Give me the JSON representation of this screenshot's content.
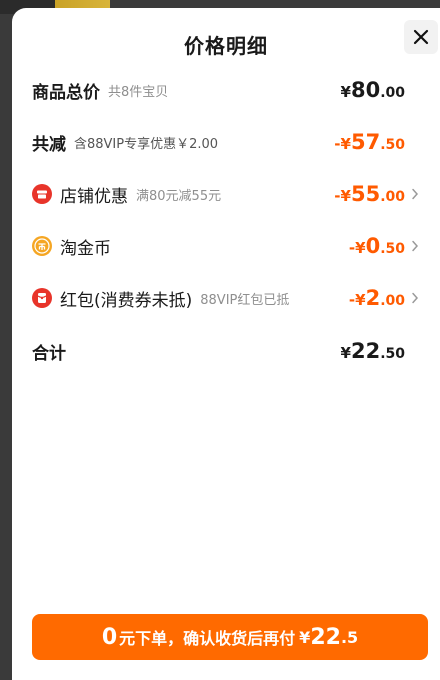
{
  "header": {
    "title": "价格明细"
  },
  "rows": {
    "total": {
      "label": "商品总价",
      "note": "共8件宝贝",
      "sign": "¥",
      "int": "80",
      "dec": ".00"
    },
    "reduce": {
      "label": "共减",
      "note": "含88VIP专享优惠￥2.00",
      "sign": "-¥",
      "int": "57",
      "dec": ".50"
    },
    "shop": {
      "label": "店铺优惠",
      "note": "满80元减55元",
      "sign": "-¥",
      "int": "55",
      "dec": ".00",
      "icon": "shop-badge-icon"
    },
    "coin": {
      "label": "淘金币",
      "sign": "-¥",
      "int": "0",
      "dec": ".50",
      "icon": "coin-icon"
    },
    "packet": {
      "label": "红包(消费券未抵)",
      "note": "88VIP红包已抵",
      "sign": "-¥",
      "int": "2",
      "dec": ".00",
      "icon": "red-packet-icon"
    },
    "sum": {
      "label": "合计",
      "sign": "¥",
      "int": "22",
      "dec": ".50"
    }
  },
  "cta": {
    "zero": "0",
    "text": "元下单，确认收货后再付",
    "sym": "¥",
    "int": "22",
    "dec": ".5"
  },
  "colors": {
    "accent": "#ff5a00",
    "button": "#ff6a00",
    "packet_red": "#e8342a",
    "coin_orange": "#f5a623"
  }
}
